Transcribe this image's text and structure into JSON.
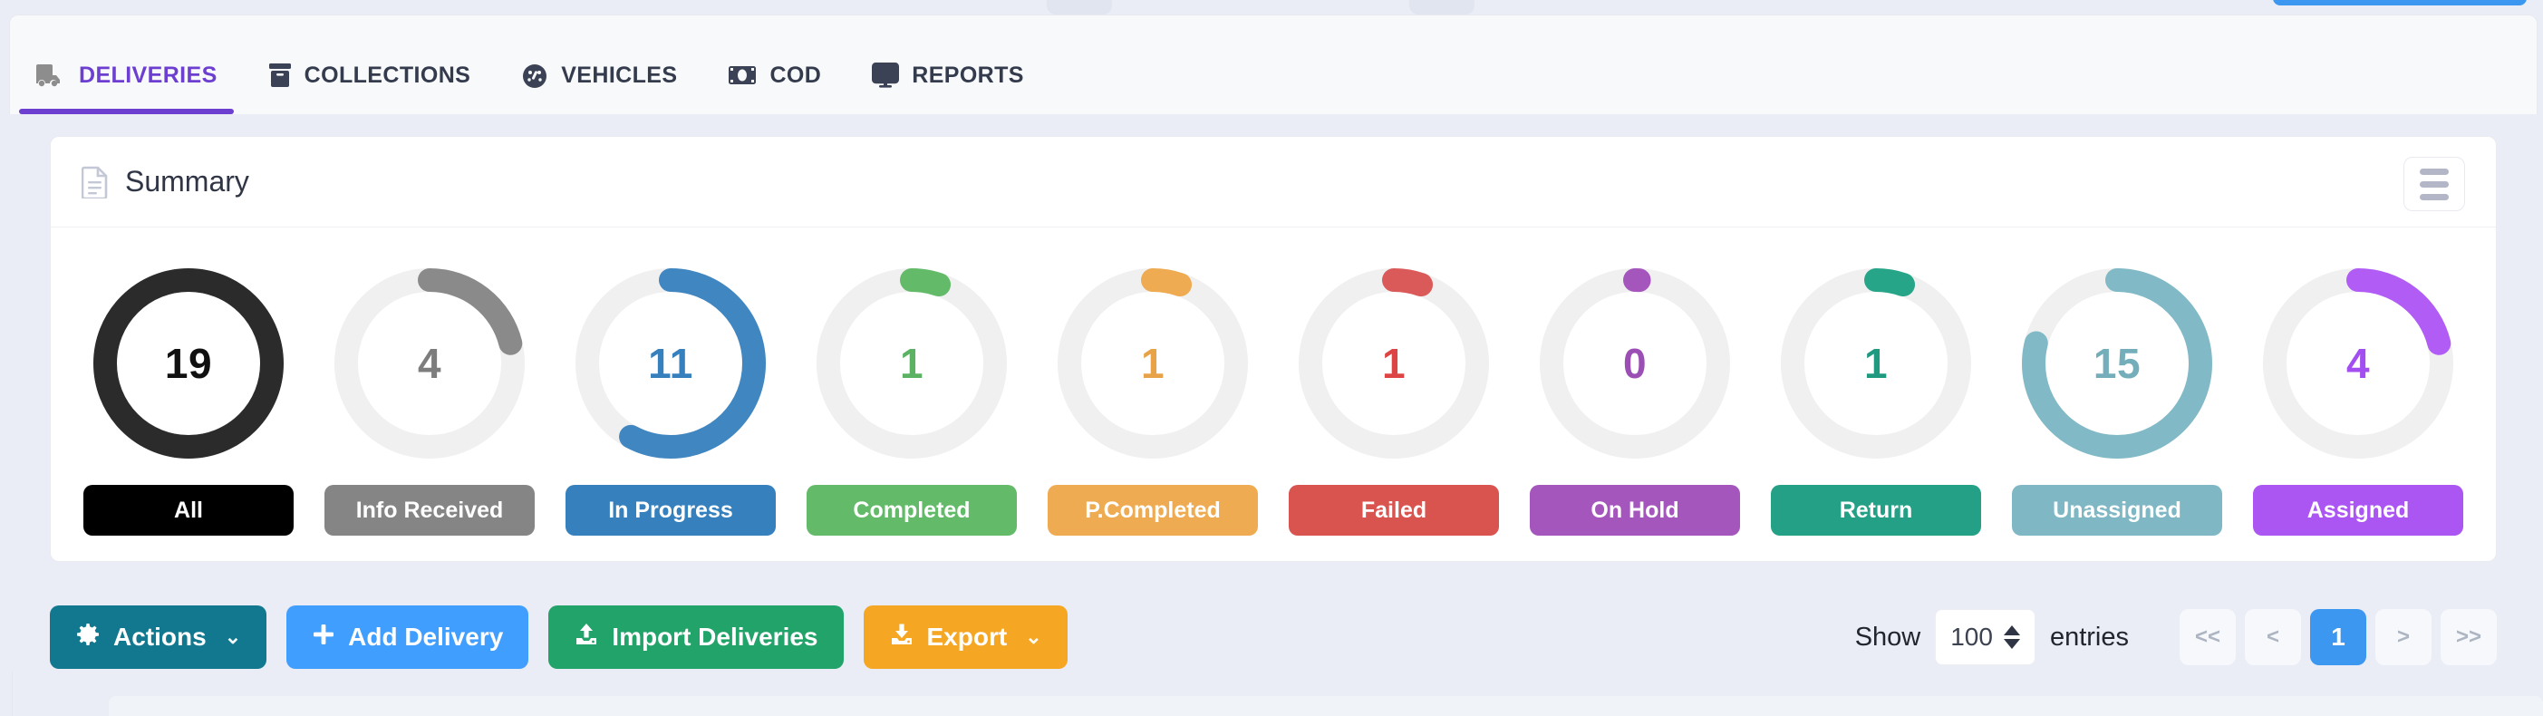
{
  "tabs": [
    {
      "label": "DELIVERIES",
      "icon": "truck-icon",
      "active": true
    },
    {
      "label": "COLLECTIONS",
      "icon": "box-icon",
      "active": false
    },
    {
      "label": "VEHICLES",
      "icon": "gauge-icon",
      "active": false
    },
    {
      "label": "COD",
      "icon": "money-icon",
      "active": false
    },
    {
      "label": "REPORTS",
      "icon": "monitor-icon",
      "active": false
    }
  ],
  "summary": {
    "title": "Summary",
    "doc_icon": "document-icon",
    "menu_icon": "hamburger-icon"
  },
  "chart_data": {
    "type": "pie",
    "title": "Summary",
    "total": 19,
    "legend": "below each donut",
    "categories": [
      "All",
      "Info Received",
      "In Progress",
      "Completed",
      "P.Completed",
      "Failed",
      "On Hold",
      "Return",
      "Unassigned",
      "Assigned"
    ],
    "values": [
      19,
      4,
      11,
      1,
      1,
      1,
      0,
      1,
      15,
      4
    ],
    "percent_of_total": [
      100,
      21.1,
      57.9,
      5.3,
      5.3,
      5.3,
      0,
      5.3,
      78.9,
      21.1
    ],
    "colors": [
      "#2b2b2b",
      "#8a8a8a",
      "#4086c1",
      "#63bb6a",
      "#eeab51",
      "#da5a5a",
      "#a556bd",
      "#27a589",
      "#81bac6",
      "#b05cf5"
    ],
    "track_color": "#f0f0f0"
  },
  "donuts": [
    {
      "label": "All",
      "value": "19",
      "pct": 100,
      "color": "#2b2b2b",
      "pill_color": "#000000",
      "value_color": "#111111",
      "track": "#ffffff"
    },
    {
      "label": "Info Received",
      "value": "4",
      "pct": 21.1,
      "color": "#8a8a8a",
      "pill_color": "#858585",
      "value_color": "#7d7d7d",
      "track": "#f0f0f0"
    },
    {
      "label": "In Progress",
      "value": "11",
      "pct": 57.9,
      "color": "#4086c1",
      "pill_color": "#3580bd",
      "value_color": "#3580bd",
      "track": "#f0f0f0"
    },
    {
      "label": "Completed",
      "value": "1",
      "pct": 5.3,
      "color": "#63bb6a",
      "pill_color": "#63bb6a",
      "value_color": "#5cb263",
      "track": "#f0f0f0"
    },
    {
      "label": "P.Completed",
      "value": "1",
      "pct": 5.3,
      "color": "#eeab51",
      "pill_color": "#eeab51",
      "value_color": "#e8a348",
      "track": "#f0f0f0"
    },
    {
      "label": "Failed",
      "value": "1",
      "pct": 5.3,
      "color": "#da5a5a",
      "pill_color": "#d9534f",
      "value_color": "#d44",
      "track": "#f0f0f0"
    },
    {
      "label": "On Hold",
      "value": "0",
      "pct": 0.8,
      "color": "#a556bd",
      "pill_color": "#a556bd",
      "value_color": "#9b4fb5",
      "track": "#f0f0f0"
    },
    {
      "label": "Return",
      "value": "1",
      "pct": 5.3,
      "color": "#27a589",
      "pill_color": "#23a086",
      "value_color": "#1f9a80",
      "track": "#f0f0f0"
    },
    {
      "label": "Unassigned",
      "value": "15",
      "pct": 78.9,
      "color": "#81bac6",
      "pill_color": "#7fb8c4",
      "value_color": "#74aebb",
      "track": "#f0f0f0"
    },
    {
      "label": "Assigned",
      "value": "4",
      "pct": 21.1,
      "color": "#b05cf5",
      "pill_color": "#ab55f2",
      "value_color": "#a24ef0",
      "track": "#f0f0f0"
    }
  ],
  "toolbar": {
    "actions_label": "Actions",
    "actions_caret": "⌄",
    "add_label": "Add Delivery",
    "import_label": "Import Deliveries",
    "export_label": "Export",
    "export_caret": "⌄",
    "actions_icon": "gear-icon",
    "add_icon": "plus-icon",
    "import_icon": "upload-icon",
    "export_icon": "download-icon"
  },
  "pagination": {
    "show_label": "Show",
    "entries_label": "entries",
    "page_size": "100",
    "first_label": "<<",
    "prev_label": "<",
    "current_page": "1",
    "next_label": ">",
    "last_label": ">>"
  }
}
